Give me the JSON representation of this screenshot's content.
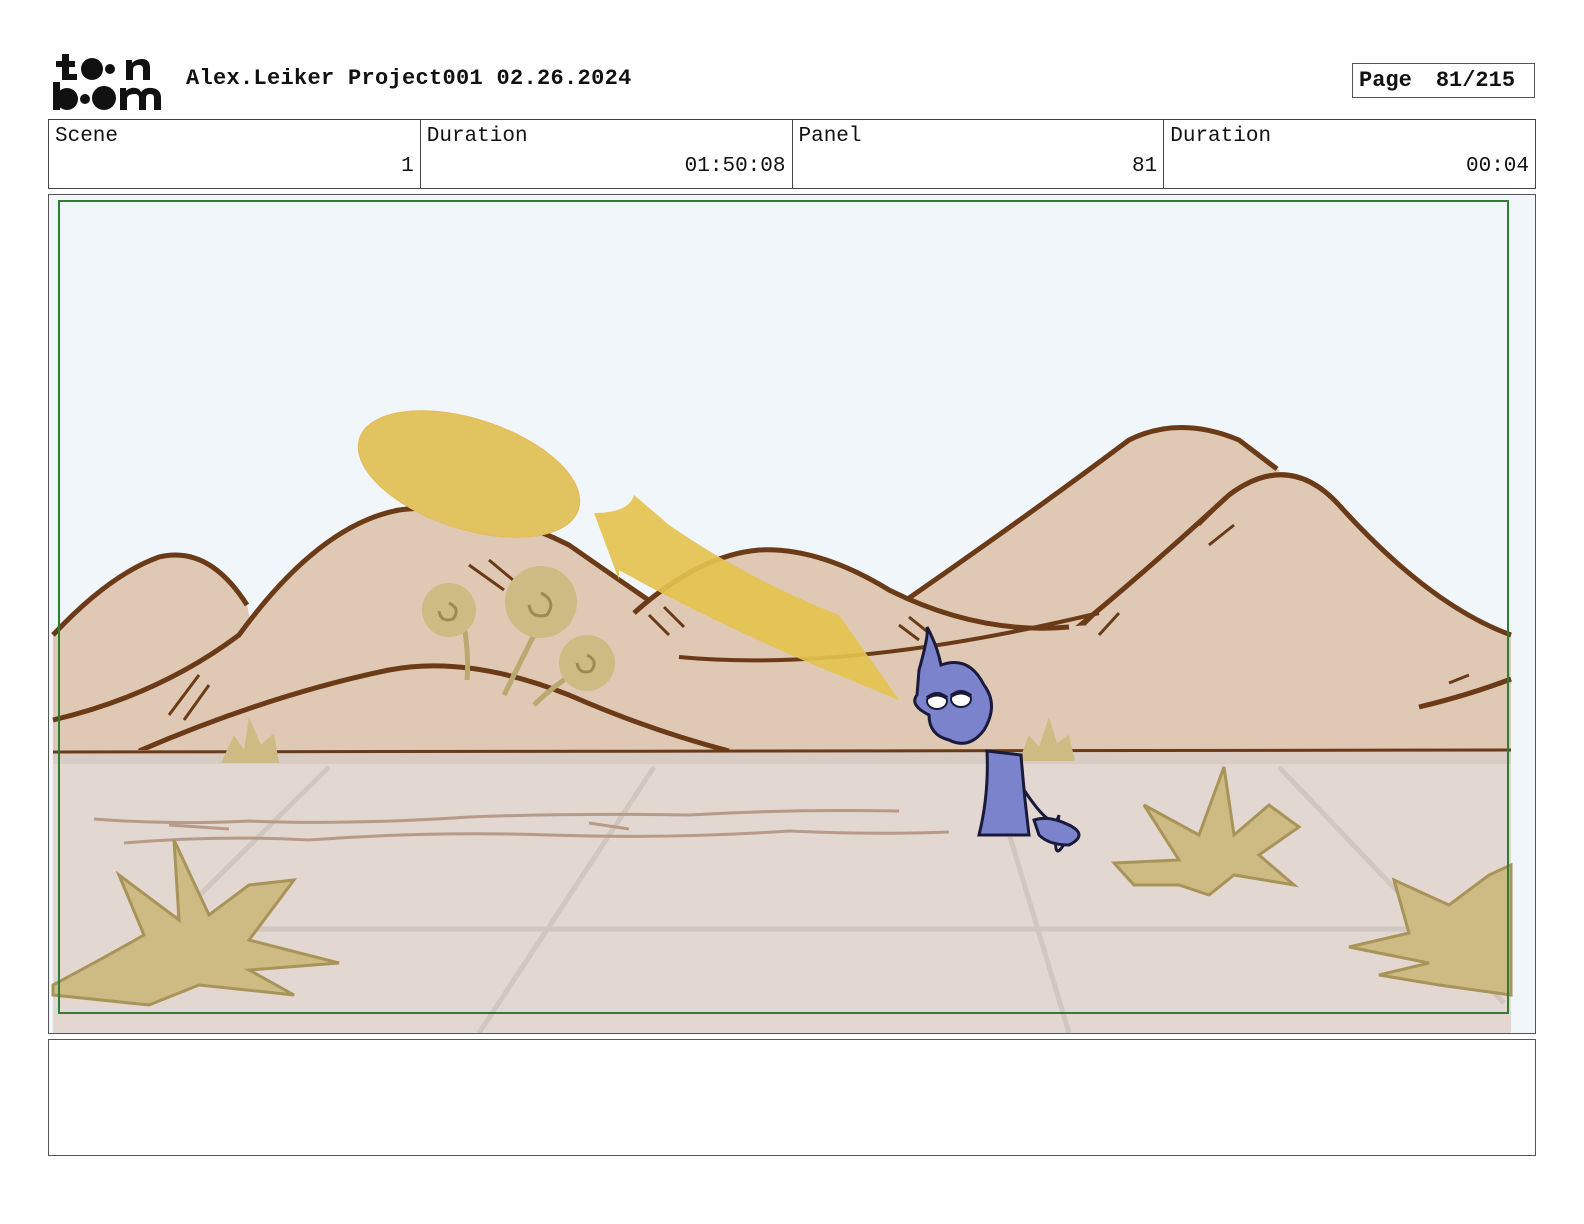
{
  "header": {
    "logo_alt": "toon boom",
    "project_title": "Alex.Leiker Project001 02.26.2024",
    "page_label": "Page",
    "page_number": "81/215"
  },
  "info": {
    "scene_label": "Scene",
    "scene_value": "1",
    "scene_duration_label": "Duration",
    "scene_duration_value": "01:50:08",
    "panel_label": "Panel",
    "panel_value": "81",
    "panel_duration_label": "Duration",
    "panel_duration_value": "00:04"
  },
  "panel": {
    "illustration": "desert-hills-creature-beam",
    "colors": {
      "sky": "#f1f6fb",
      "hills": "#dfc8b4",
      "hill_outline": "#6b3a17",
      "ground": "#e3d7d1",
      "grass": "#cdbb83",
      "beam": "#e4c24f",
      "creature": "#7b83cc",
      "safe_frame": "#2e7d32"
    }
  },
  "notes": {
    "text": ""
  }
}
